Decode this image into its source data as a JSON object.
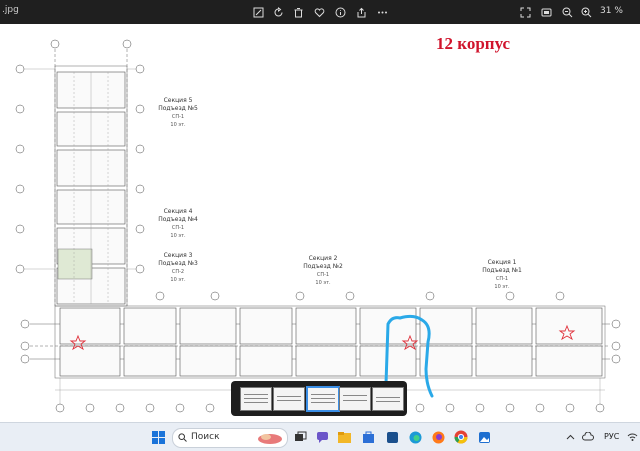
{
  "viewer": {
    "filename": ".jpg",
    "zoom": "31 %",
    "toolbar_icons": [
      "edit-image-icon",
      "rotate-icon",
      "delete-icon",
      "favorite-icon",
      "info-icon",
      "share-icon"
    ],
    "right_icons": [
      "fullscreen-icon",
      "fit-icon",
      "zoom-out-icon",
      "zoom-in-icon"
    ]
  },
  "plan": {
    "title": "12 корпус",
    "sections": [
      {
        "name": "Секция 5",
        "entrance": "Подъезд №5",
        "code": "СП-1",
        "floors": "10 эт."
      },
      {
        "name": "Секция 4",
        "entrance": "Подъезд №4",
        "code": "СП-1",
        "floors": "10 эт."
      },
      {
        "name": "Секция 3",
        "entrance": "Подъезд №3",
        "code": "СП-2",
        "floors": "10 эт."
      },
      {
        "name": "Секция 2",
        "entrance": "Подъезд №2",
        "code": "СП-1",
        "floors": "10 эт."
      },
      {
        "name": "Секция 1",
        "entrance": "Подъезд №1",
        "code": "СП-1",
        "floors": "10 эт."
      }
    ],
    "colors": {
      "title": "#d0142c",
      "highlight": "#2aa9e8",
      "stars": "#e0303a"
    }
  },
  "filmstrip": {
    "count": 5,
    "selected": 3
  },
  "taskbar": {
    "search_placeholder": "Поиск",
    "lang": "РУС",
    "apps": [
      "task-view-icon",
      "chat-icon",
      "file-explorer-icon",
      "store-icon",
      "edge-icon",
      "firefox-icon",
      "chrome-icon",
      "photos-icon"
    ]
  }
}
